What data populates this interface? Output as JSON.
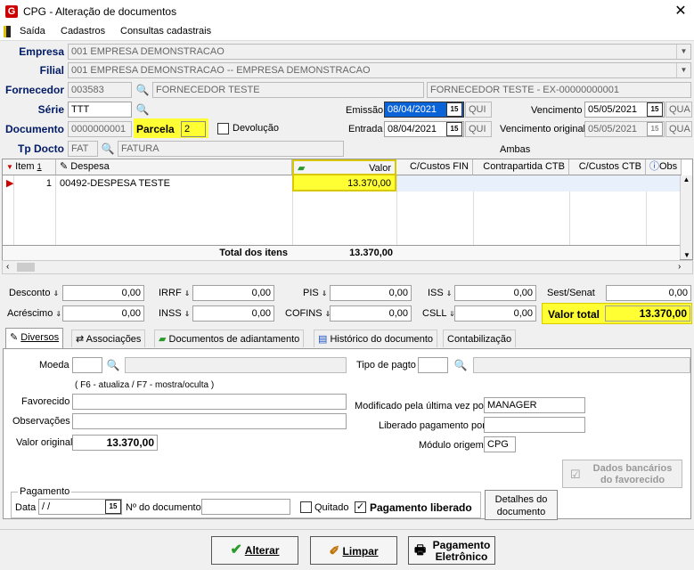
{
  "window": {
    "title": "CPG - Alteração de documentos",
    "close": "✕"
  },
  "menu": {
    "saida": "Saída",
    "cadastros": "Cadastros",
    "consultas": "Consultas cadastrais"
  },
  "header": {
    "empresa_label": "Empresa",
    "empresa_value": "001 EMPRESA DEMONSTRACAO",
    "filial_label": "Filial",
    "filial_value": "001 EMPRESA DEMONSTRACAO -- EMPRESA DEMONSTRACAO",
    "fornecedor_label": "Fornecedor",
    "fornecedor_code": "003583",
    "fornecedor_name": "FORNECEDOR TESTE",
    "fornecedor_full": "FORNECEDOR TESTE - EX-00000000001",
    "serie_label": "Série",
    "serie_value": "TTT",
    "emissao_label": "Emissão",
    "emissao_value": "08/04/2021",
    "emissao_day": "QUI",
    "vencimento_label": "Vencimento",
    "vencimento_value": "05/05/2021",
    "vencimento_day": "QUA",
    "documento_label": "Documento",
    "documento_value": "0000000001",
    "parcela_label": "Parcela",
    "parcela_value": "2",
    "devolucao_label": "Devolução",
    "entrada_label": "Entrada",
    "entrada_value": "08/04/2021",
    "entrada_day": "QUI",
    "venc_original_label": "Vencimento original",
    "venc_original_value": "05/05/2021",
    "venc_original_day": "QUA",
    "tpdocto_label": "Tp Docto",
    "tpdocto_code": "FAT",
    "tpdocto_name": "FATURA",
    "ambas_label": "Ambas"
  },
  "grid": {
    "columns": {
      "item": "Item",
      "sort": "1",
      "despesa": "Despesa",
      "valor": "Valor",
      "custos_fin": "C/Custos FIN",
      "contrapartida": "Contrapartida CTB",
      "custos_ctb": "C/Custos CTB",
      "obs": "Obs"
    },
    "rows": [
      {
        "item": "1",
        "despesa": "00492-DESPESA TESTE",
        "valor": "13.370,00"
      }
    ],
    "total_label": "Total dos itens",
    "total_value": "13.370,00"
  },
  "taxes": {
    "desconto_label": "Desconto",
    "desconto": "0,00",
    "acrescimo_label": "Acréscimo",
    "acrescimo": "0,00",
    "irrf_label": "IRRF",
    "irrf": "0,00",
    "inss_label": "INSS",
    "inss": "0,00",
    "pis_label": "PIS",
    "pis": "0,00",
    "cofins_label": "COFINS",
    "cofins": "0,00",
    "iss_label": "ISS",
    "iss": "0,00",
    "csll_label": "CSLL",
    "csll": "0,00",
    "sest_label": "Sest/Senat",
    "sest": "0,00",
    "valor_total_label": "Valor total",
    "valor_total": "13.370,00"
  },
  "tabs": [
    "Diversos",
    "Associações",
    "Documentos de adiantamento",
    "Histórico do documento",
    "Contabilização"
  ],
  "diversos": {
    "moeda_label": "Moeda",
    "tipo_pagto_label": "Tipo de pagto",
    "hint": "( F6 - atualiza / F7 - mostra/oculta )",
    "favorecido_label": "Favorecido",
    "observacoes_label": "Observações",
    "valor_original_label": "Valor original",
    "valor_original": "13.370,00",
    "modificado_label": "Modificado pela última vez por",
    "modificado_value": "MANAGER",
    "liberado_label": "Liberado pagamento por",
    "modulo_label": "Módulo origem",
    "modulo_value": "CPG",
    "dados_bancarios": "Dados bancários do favorecido",
    "pagamento_group": "Pagamento",
    "data_label": "Data",
    "data_value": " / /",
    "ndoc_label": "Nº do documento",
    "quitado_label": "Quitado",
    "pag_liberado_label": "Pagamento liberado",
    "detalhes": "Detalhes do documento"
  },
  "buttons": {
    "alterar": "Alterar",
    "limpar": "Limpar",
    "pag_eletronico": "Pagamento Eletrônico"
  }
}
